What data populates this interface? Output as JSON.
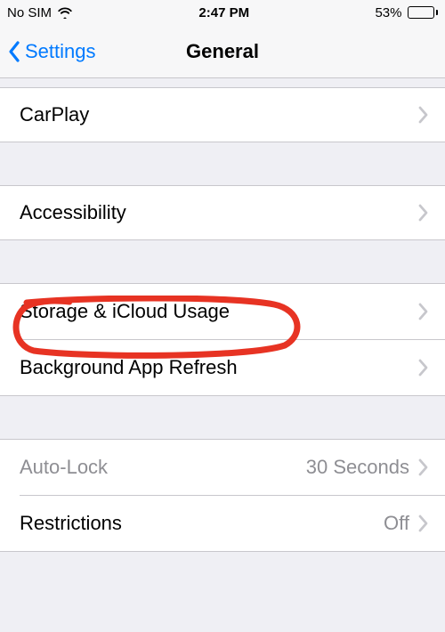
{
  "status_bar": {
    "carrier": "No SIM",
    "time": "2:47 PM",
    "battery_percent": "53%"
  },
  "nav": {
    "back_label": "Settings",
    "title": "General"
  },
  "rows": {
    "carplay": "CarPlay",
    "accessibility": "Accessibility",
    "storage": "Storage & iCloud Usage",
    "background_refresh": "Background App Refresh",
    "auto_lock": "Auto-Lock",
    "auto_lock_value": "30 Seconds",
    "restrictions": "Restrictions",
    "restrictions_value": "Off"
  }
}
